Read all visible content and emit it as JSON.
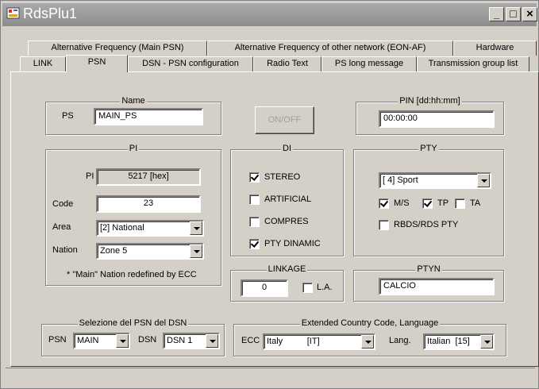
{
  "window": {
    "title": "RdsPlu1",
    "title_color": "#ffffff",
    "controls": {
      "minimize": "_",
      "maximize": "□",
      "close": "×"
    }
  },
  "tabs": {
    "row1": [
      "Alternative Frequency (Main PSN)",
      "Alternative Frequency of other network (EON-AF)",
      "Hardware"
    ],
    "row2": [
      "LINK",
      "PSN",
      "DSN - PSN configuration",
      "Radio Text",
      "PS long message",
      "Transmission group list"
    ],
    "active": "PSN"
  },
  "name_group": {
    "label": "Name",
    "ps_label": "PS",
    "ps_value": "MAIN_PS"
  },
  "onoff_button": {
    "label": "ON/OFF",
    "enabled": false
  },
  "pin_group": {
    "label": "PIN [dd:hh:mm]",
    "value": "00:00:00"
  },
  "pi_group": {
    "label": "PI",
    "pi_label": "PI",
    "pi_value": "5217 [hex]",
    "code_label": "Code",
    "code_value": "23",
    "area_label": "Area",
    "area_value": "[2] National",
    "nation_label": "Nation",
    "nation_value": "Zone 5",
    "note": "* \"Main\" Nation redefined by ECC"
  },
  "di_group": {
    "label": "DI",
    "items": [
      {
        "label": "STEREO",
        "checked": true
      },
      {
        "label": "ARTIFICIAL",
        "checked": false
      },
      {
        "label": "COMPRES",
        "checked": false
      },
      {
        "label": "PTY DINAMIC",
        "checked": true
      }
    ]
  },
  "pty_group": {
    "label": "PTY",
    "value": "[ 4] Sport",
    "ms_label": "M/S",
    "ms_checked": true,
    "tp_label": "TP",
    "tp_checked": true,
    "ta_label": "TA",
    "ta_checked": false,
    "rbds_label": "RBDS/RDS PTY",
    "rbds_checked": false
  },
  "linkage_group": {
    "label": "LINKAGE",
    "value": "0",
    "la_label": "L.A.",
    "la_checked": false
  },
  "ptyn_group": {
    "label": "PTYN",
    "value": "CALCIO"
  },
  "selezione_group": {
    "label": "Selezione del PSN del  DSN",
    "psn_label": "PSN",
    "psn_value": "MAIN",
    "dsn_label": "DSN",
    "dsn_value": "DSN 1"
  },
  "ecc_group": {
    "label": "Extended Country Code,  Language",
    "ecc_label": "ECC",
    "ecc_value": "Italy          [IT]",
    "lang_label": "Lang.",
    "lang_value": "Italian  [15]"
  }
}
